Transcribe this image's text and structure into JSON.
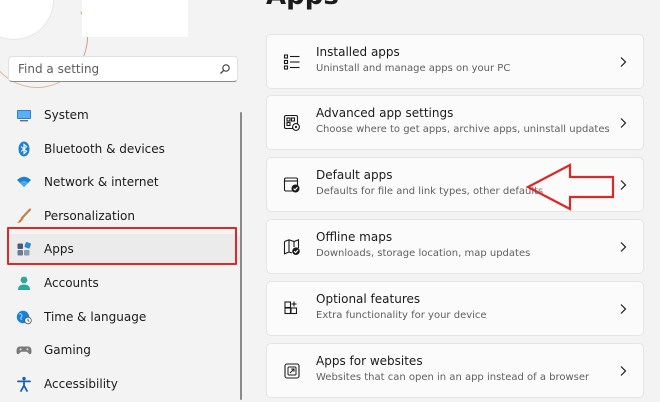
{
  "search": {
    "placeholder": "Find a setting"
  },
  "nav": {
    "items": [
      {
        "label": "System",
        "icon": "monitor-icon"
      },
      {
        "label": "Bluetooth & devices",
        "icon": "bluetooth-icon"
      },
      {
        "label": "Network & internet",
        "icon": "wifi-icon"
      },
      {
        "label": "Personalization",
        "icon": "paintbrush-icon"
      },
      {
        "label": "Apps",
        "icon": "apps-icon",
        "selected": true
      },
      {
        "label": "Accounts",
        "icon": "person-icon"
      },
      {
        "label": "Time & language",
        "icon": "globe-clock-icon"
      },
      {
        "label": "Gaming",
        "icon": "gamepad-icon"
      },
      {
        "label": "Accessibility",
        "icon": "accessibility-icon"
      }
    ]
  },
  "page": {
    "title": "Apps"
  },
  "cards": [
    {
      "title": "Installed apps",
      "desc": "Uninstall and manage apps on your PC",
      "icon": "list-icon"
    },
    {
      "title": "Advanced app settings",
      "desc": "Choose where to get apps, archive apps, uninstall updates",
      "icon": "app-settings-icon"
    },
    {
      "title": "Default apps",
      "desc": "Defaults for file and link types, other defaults",
      "icon": "default-apps-icon"
    },
    {
      "title": "Offline maps",
      "desc": "Downloads, storage location, map updates",
      "icon": "map-icon"
    },
    {
      "title": "Optional features",
      "desc": "Extra functionality for your device",
      "icon": "add-feature-icon"
    },
    {
      "title": "Apps for websites",
      "desc": "Websites that can open in an app instead of a browser",
      "icon": "web-app-icon"
    }
  ],
  "colors": {
    "accent": "#0067c0",
    "highlight": "#d92a2a",
    "background": "#f3f3f3",
    "card": "#fbfbfb"
  }
}
